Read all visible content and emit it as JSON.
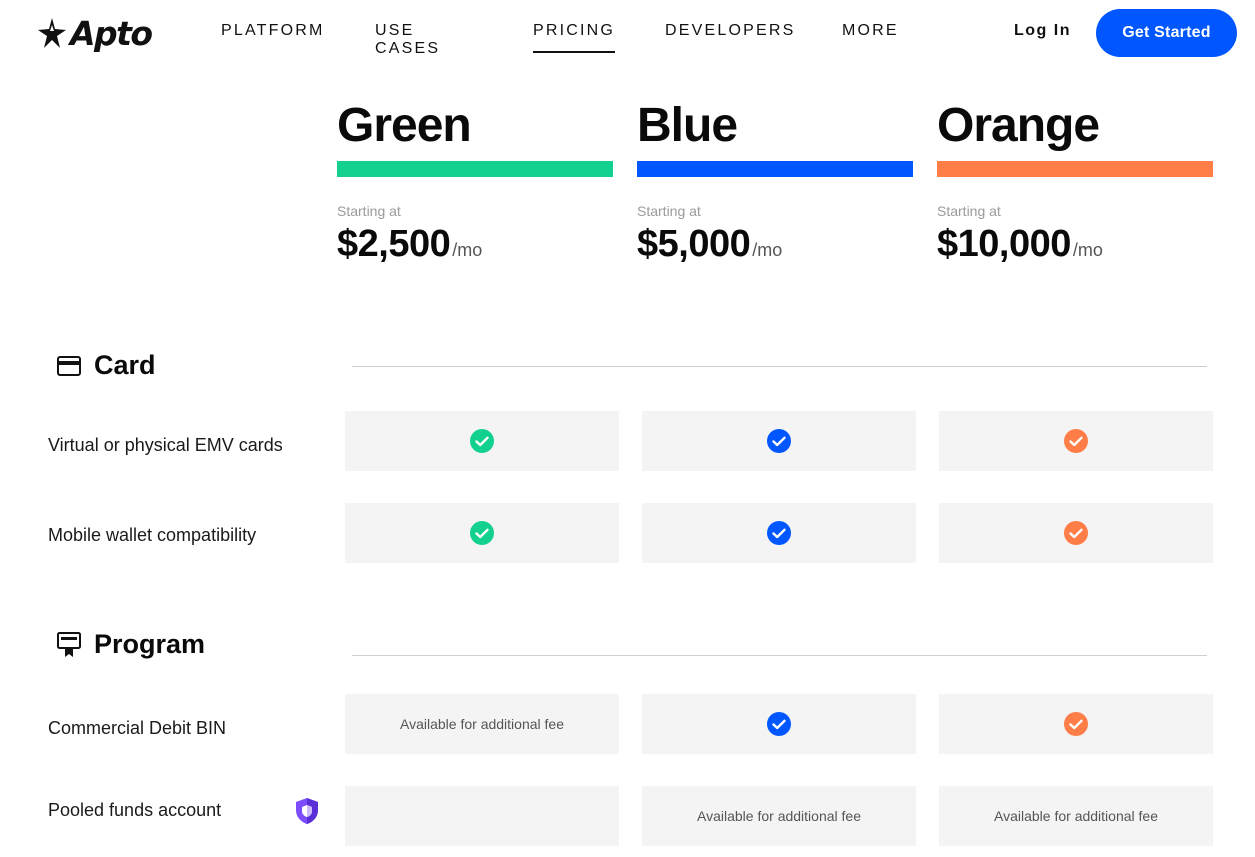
{
  "brand": {
    "name": "Apto"
  },
  "nav": {
    "items": [
      {
        "label": "PLATFORM"
      },
      {
        "label": "USE CASES"
      },
      {
        "label": "PRICING",
        "active": true
      },
      {
        "label": "DEVELOPERS"
      },
      {
        "label": "MORE"
      }
    ],
    "login": "Log In",
    "cta": "Get Started"
  },
  "colors": {
    "green": "#12d18e",
    "blue": "#0057ff",
    "orange": "#ff7d47"
  },
  "plans": [
    {
      "name": "Green",
      "starting": "Starting at",
      "price": "$2,500",
      "unit": "/mo",
      "color": "#12d18e"
    },
    {
      "name": "Blue",
      "starting": "Starting at",
      "price": "$5,000",
      "unit": "/mo",
      "color": "#0057ff"
    },
    {
      "name": "Orange",
      "starting": "Starting at",
      "price": "$10,000",
      "unit": "/mo",
      "color": "#ff7d47"
    }
  ],
  "sections": [
    {
      "title": "Card",
      "icon": "credit-card-icon",
      "rows": [
        {
          "label": "Virtual or physical EMV cards",
          "cells": [
            "check",
            "check",
            "check"
          ]
        },
        {
          "label": "Mobile wallet compatibility",
          "cells": [
            "check",
            "check",
            "check"
          ]
        }
      ]
    },
    {
      "title": "Program",
      "icon": "certificate-icon",
      "rows": [
        {
          "label": "Commercial Debit BIN",
          "cells": [
            "Available for additional fee",
            "check",
            "check"
          ]
        },
        {
          "label": "Pooled funds account",
          "cells": [
            "",
            "Available for additional fee",
            "Available for additional fee"
          ],
          "badge": "shield-icon"
        }
      ]
    }
  ]
}
